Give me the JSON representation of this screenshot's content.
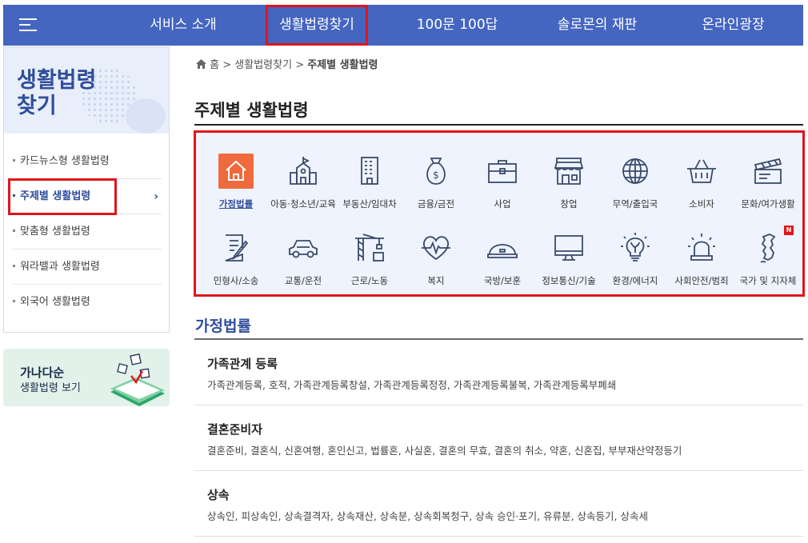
{
  "nav": {
    "items": [
      "서비스 소개",
      "생활법령찾기",
      "100문 100답",
      "솔로몬의 재판",
      "온라인광장"
    ],
    "active_index": 1
  },
  "sidebar": {
    "title": "생활법령\n찾기",
    "items": [
      {
        "label": "카드뉴스형 생활법령"
      },
      {
        "label": "주제별 생활법령",
        "active": true
      },
      {
        "label": "맞춤형 생활법령"
      },
      {
        "label": "워라밸과 생활법령"
      },
      {
        "label": "외국어 생활법령"
      }
    ],
    "chevron": "›"
  },
  "promo": {
    "line1": "가나다순",
    "line2": "생활법령 보기"
  },
  "breadcrumb": {
    "home": "홈",
    "sep": ">",
    "level1": "생활법령찾기",
    "current": "주제별 생활법령"
  },
  "page_title": "주제별 생활법령",
  "categories": [
    {
      "label": "가정법률",
      "icon": "house-icon",
      "selected": true
    },
    {
      "label": "아동·청소년/교육",
      "icon": "school-icon"
    },
    {
      "label": "부동산/임대차",
      "icon": "building-icon"
    },
    {
      "label": "금융/금전",
      "icon": "money-bag-icon"
    },
    {
      "label": "사업",
      "icon": "briefcase-icon"
    },
    {
      "label": "창업",
      "icon": "storefront-icon"
    },
    {
      "label": "무역/출입국",
      "icon": "globe-icon"
    },
    {
      "label": "소비자",
      "icon": "basket-icon"
    },
    {
      "label": "문화/여가생활",
      "icon": "clapperboard-icon"
    },
    {
      "label": "민형사/소송",
      "icon": "document-pen-icon"
    },
    {
      "label": "교통/운전",
      "icon": "car-icon"
    },
    {
      "label": "근로/노동",
      "icon": "crane-icon"
    },
    {
      "label": "복지",
      "icon": "heartbeat-icon"
    },
    {
      "label": "국방/보훈",
      "icon": "helmet-icon"
    },
    {
      "label": "정보통신/기술",
      "icon": "monitor-icon"
    },
    {
      "label": "환경/에너지",
      "icon": "lightbulb-icon"
    },
    {
      "label": "사회안전/범죄",
      "icon": "siren-icon"
    },
    {
      "label": "국가 및 지자체",
      "icon": "korea-map-icon",
      "badge": "N"
    }
  ],
  "section": {
    "title": "가정법률",
    "groups": [
      {
        "title": "가족관계 등록",
        "items": "가족관계등록, 호적, 가족관계등록창설, 가족관계등록정정, 가족관계등록불복, 가족관계등록부폐쇄"
      },
      {
        "title": "결혼준비자",
        "items": "결혼준비, 결혼식, 신혼여행, 혼인신고, 법률혼, 사실혼, 결혼의 무효, 결혼의 취소, 약혼, 신혼집, 부부재산약정등기"
      },
      {
        "title": "상속",
        "items": "상속인, 피상속인, 상속결격자, 상속재산, 상속분, 상속회복청구, 상속 승인·포기, 유류분, 상속등기, 상속세"
      }
    ]
  },
  "colors": {
    "nav_bg": "#4465c0",
    "accent": "#2f4d9a",
    "highlight_border": "#e0151b",
    "selected_icon_bg": "#ef6a3c",
    "panel_bg": "#eef3fd"
  }
}
